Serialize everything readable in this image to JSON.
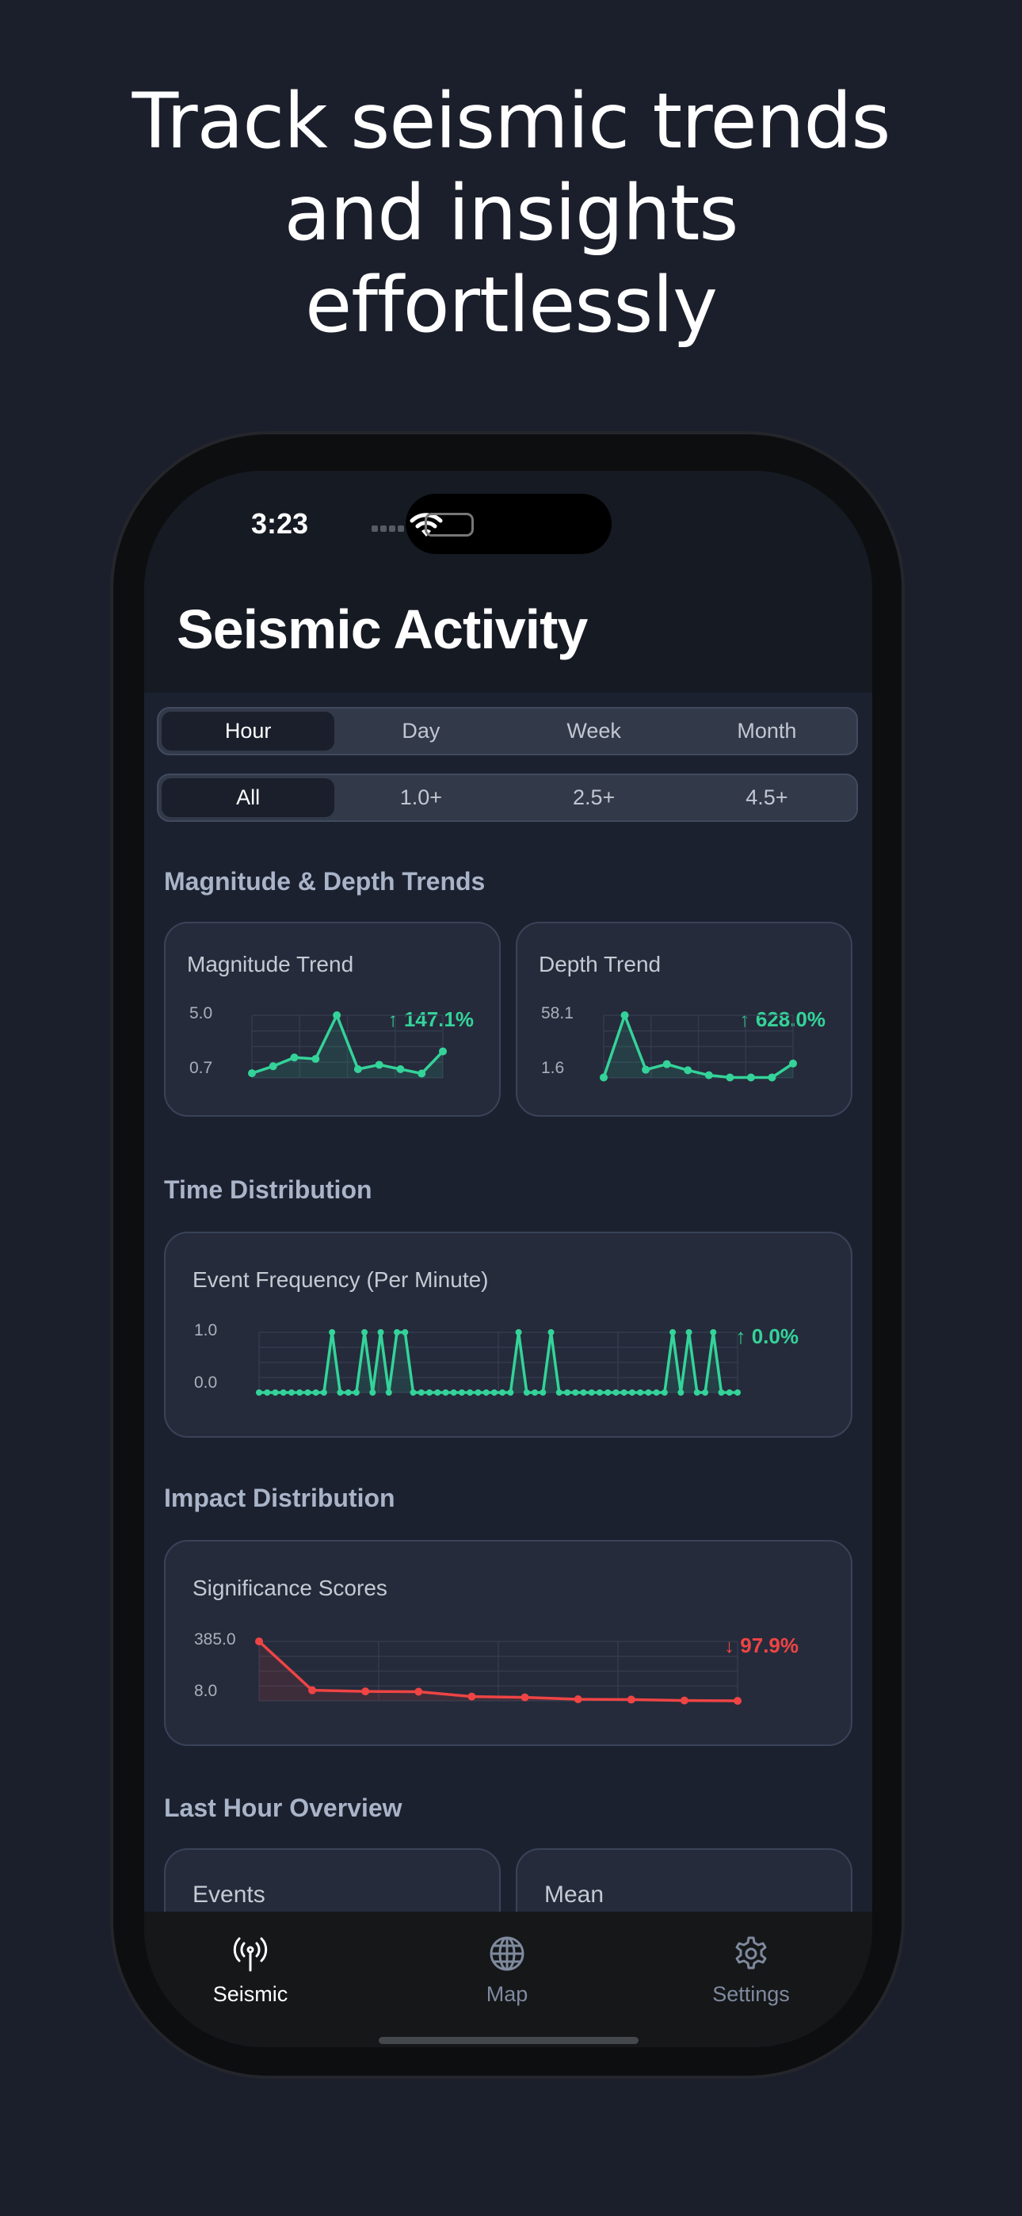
{
  "headline": [
    "Track seismic trends",
    "and insights",
    "effortlessly"
  ],
  "status": {
    "time": "3:23"
  },
  "header": {
    "title": "Seismic Activity"
  },
  "time_range": {
    "options": [
      "Hour",
      "Day",
      "Week",
      "Month"
    ],
    "selected": "Hour"
  },
  "magnitude_filter": {
    "options": [
      "All",
      "1.0+",
      "2.5+",
      "4.5+"
    ],
    "selected": "All"
  },
  "sections": {
    "trends": "Magnitude & Depth Trends",
    "time": "Time Distribution",
    "impact": "Impact Distribution",
    "overview": "Last Hour Overview"
  },
  "colors": {
    "up": "#34d399",
    "down": "#ef4444",
    "accent": "#ffffff"
  },
  "chart_data": [
    {
      "id": "magnitude",
      "type": "line",
      "title": "Magnitude Trend",
      "ymax_label": "5.0",
      "ymin_label": "0.7",
      "ylim": [
        0.7,
        5.0
      ],
      "change": "↑ 147.1%",
      "color": "#34d399",
      "values": [
        1.02,
        1.5,
        2.1,
        2.0,
        5.0,
        1.3,
        1.6,
        1.3,
        1.0,
        2.52
      ]
    },
    {
      "id": "depth",
      "type": "line",
      "title": "Depth Trend",
      "ymax_label": "58.1",
      "ymin_label": "1.6",
      "ylim": [
        1.6,
        58.1
      ],
      "change": "↑ 628.0%",
      "color": "#34d399",
      "values": [
        2.0,
        58.1,
        9.0,
        14.0,
        8.5,
        4.0,
        2.0,
        2.0,
        2.0,
        14.56
      ]
    },
    {
      "id": "frequency",
      "type": "line",
      "title": "Event Frequency (Per Minute)",
      "ymax_label": "1.0",
      "ymin_label": "0.0",
      "ylim": [
        0,
        1
      ],
      "change": "↑ 0.0%",
      "color": "#34d399",
      "values": [
        0,
        0,
        0,
        0,
        0,
        0,
        0,
        0,
        0,
        1,
        0,
        0,
        0,
        1,
        0,
        1,
        0,
        1,
        1,
        0,
        0,
        0,
        0,
        0,
        0,
        0,
        0,
        0,
        0,
        0,
        0,
        0,
        1,
        0,
        0,
        0,
        1,
        0,
        0,
        0,
        0,
        0,
        0,
        0,
        0,
        0,
        0,
        0,
        0,
        0,
        0,
        1,
        0,
        1,
        0,
        0,
        1,
        0,
        0,
        0
      ]
    },
    {
      "id": "significance",
      "type": "line",
      "title": "Significance Scores",
      "ymax_label": "385.0",
      "ymin_label": "8.0",
      "ylim": [
        8,
        385
      ],
      "change": "↓ 97.9%",
      "color": "#ef4444",
      "values": [
        385,
        75,
        68,
        66,
        35,
        30,
        18,
        16,
        10,
        8
      ]
    }
  ],
  "overview": {
    "cards": [
      "Events",
      "Mean"
    ]
  },
  "tabbar": {
    "items": [
      {
        "label": "Seismic",
        "icon": "antenna-icon",
        "active": true
      },
      {
        "label": "Map",
        "icon": "globe-icon",
        "active": false
      },
      {
        "label": "Settings",
        "icon": "gear-icon",
        "active": false
      }
    ]
  }
}
